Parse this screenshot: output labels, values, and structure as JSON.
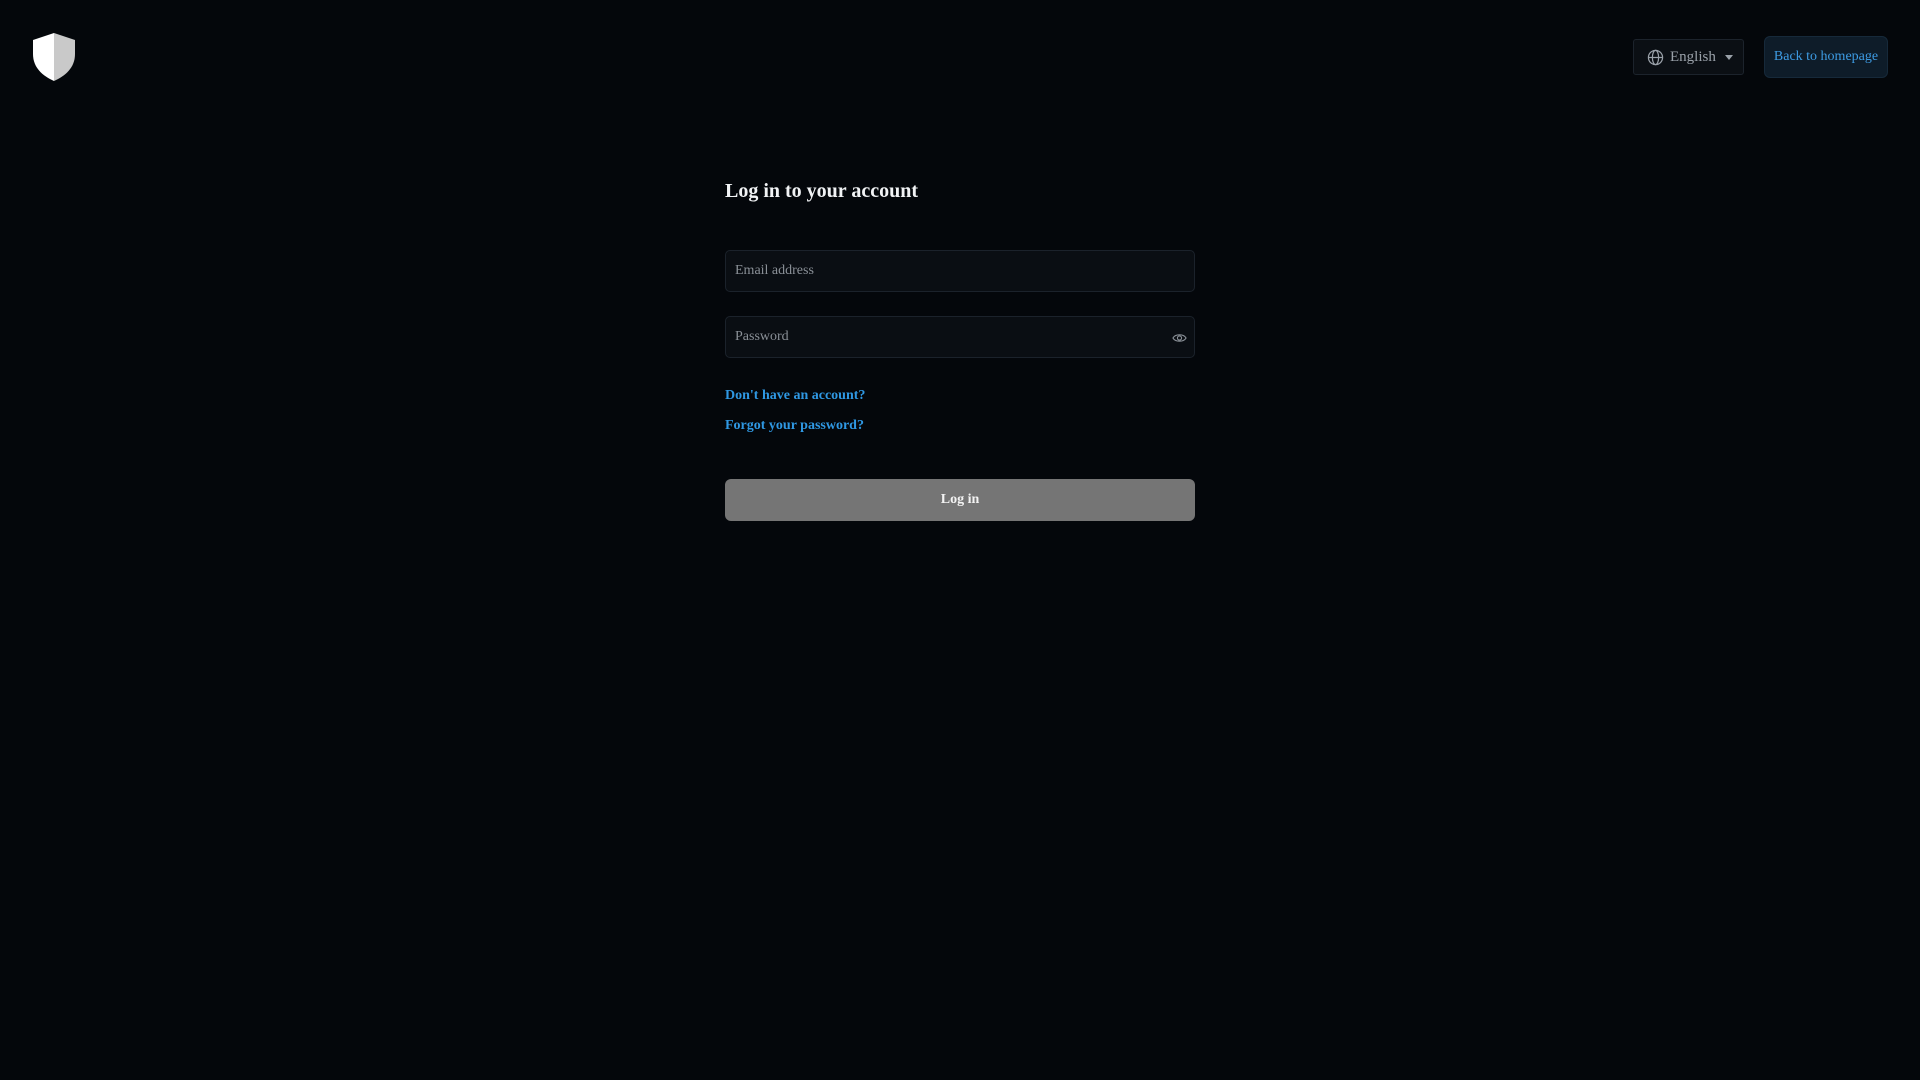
{
  "header": {
    "logo_icon": "shield-icon",
    "language": {
      "icon": "globe-icon",
      "selected": "English",
      "caret_icon": "caret-down-icon"
    },
    "back_label": "Back to homepage"
  },
  "form": {
    "title": "Log in to your account",
    "email_placeholder": "Email address",
    "email_value": "",
    "password_placeholder": "Password",
    "password_value": "",
    "password_toggle_icon": "eye-icon",
    "signup_link": "Don't have an account?",
    "forgot_link": "Forgot your password?",
    "submit_label": "Log in"
  },
  "colors": {
    "background": "#04070b",
    "link": "#2f98e3",
    "button_disabled": "#757575",
    "back_button_bg": "#0e1c29"
  }
}
